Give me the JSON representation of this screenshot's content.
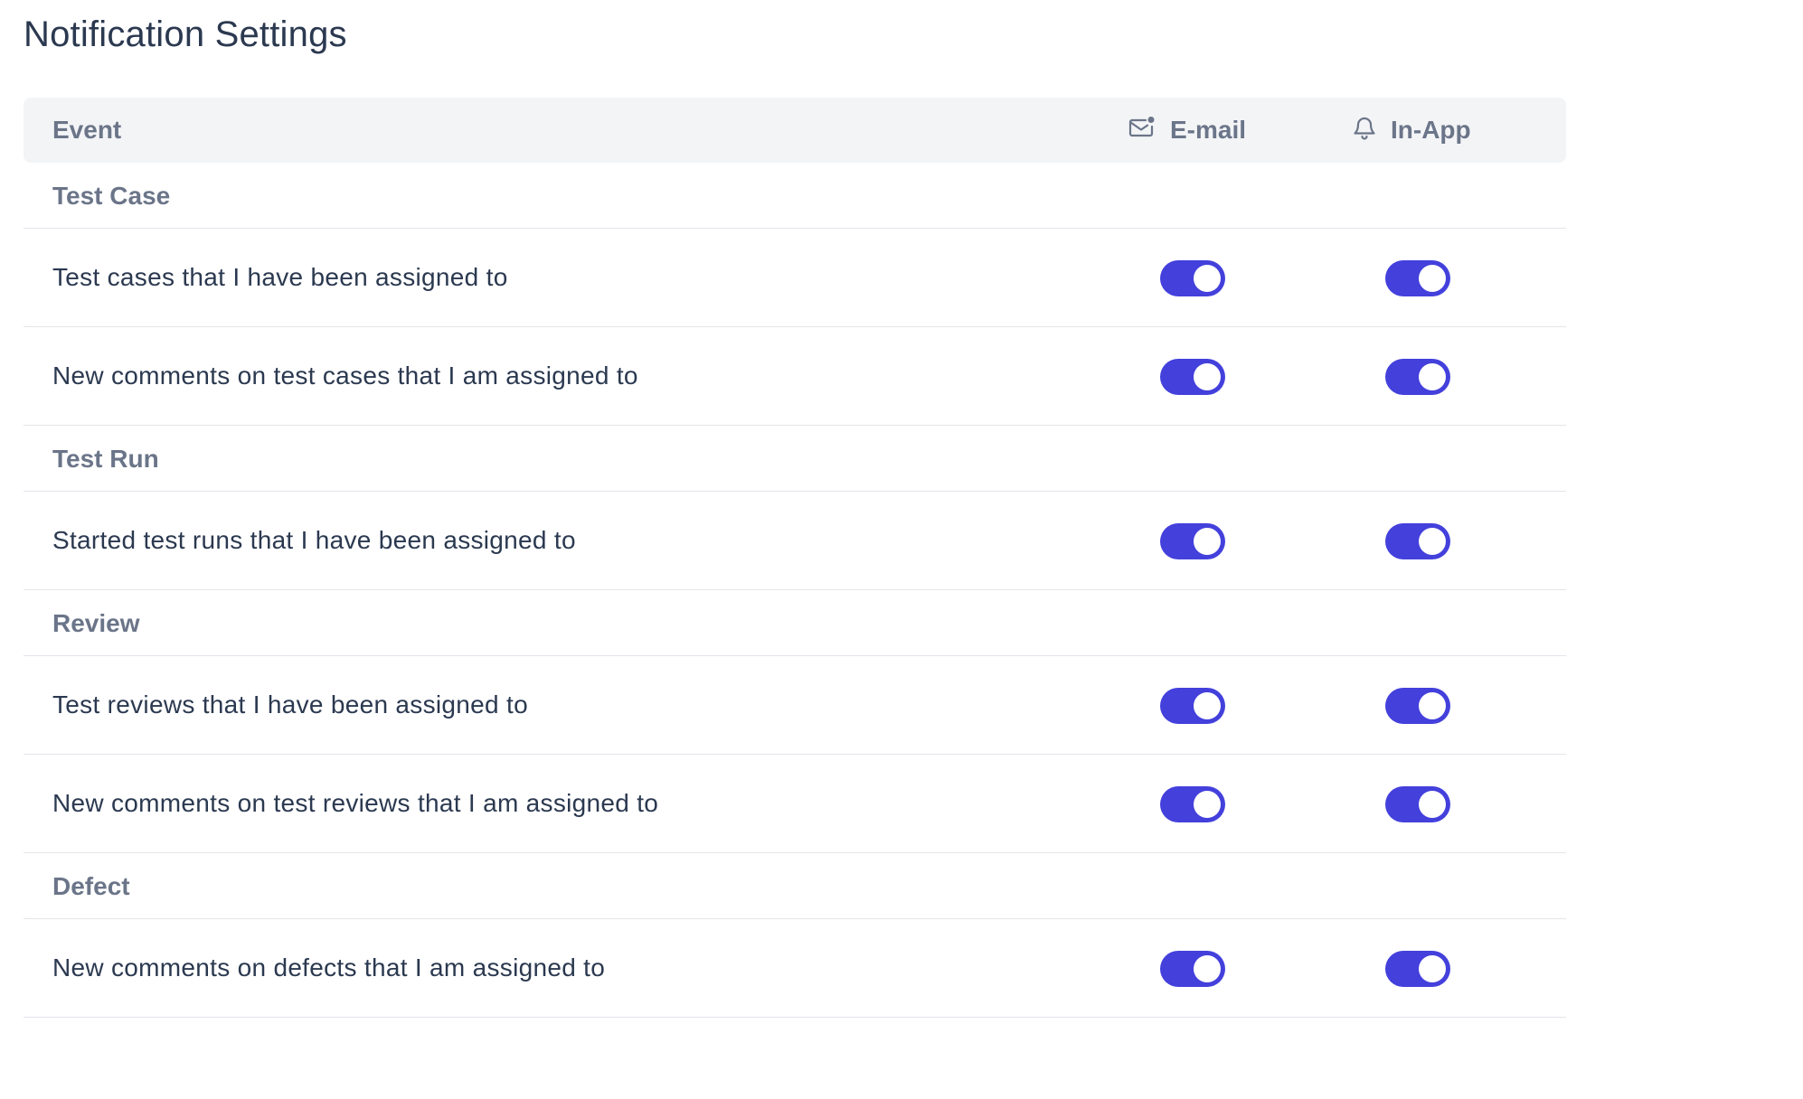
{
  "page": {
    "title": "Notification Settings"
  },
  "table": {
    "headers": {
      "event": "Event",
      "email": "E-mail",
      "in_app": "In-App",
      "email_icon": "mail-notification-icon",
      "in_app_icon": "bell-icon"
    },
    "groups": [
      {
        "label": "Test Case",
        "events": [
          {
            "label": "Test cases that I have been assigned to",
            "email": true,
            "in_app": true
          },
          {
            "label": "New comments on test cases that I am assigned to",
            "email": true,
            "in_app": true
          }
        ]
      },
      {
        "label": "Test Run",
        "events": [
          {
            "label": "Started test runs that I have been assigned to",
            "email": true,
            "in_app": true
          }
        ]
      },
      {
        "label": "Review",
        "events": [
          {
            "label": "Test reviews that I have been assigned to",
            "email": true,
            "in_app": true
          },
          {
            "label": "New comments on test reviews that I am assigned to",
            "email": true,
            "in_app": true
          }
        ]
      },
      {
        "label": "Defect",
        "events": [
          {
            "label": "New comments on defects that I am assigned to",
            "email": true,
            "in_app": true
          }
        ]
      }
    ]
  },
  "colors": {
    "toggle_on": "#4340dc",
    "header_bg": "#f3f4f6",
    "muted_text": "#6b7589",
    "body_text": "#2b3950"
  }
}
